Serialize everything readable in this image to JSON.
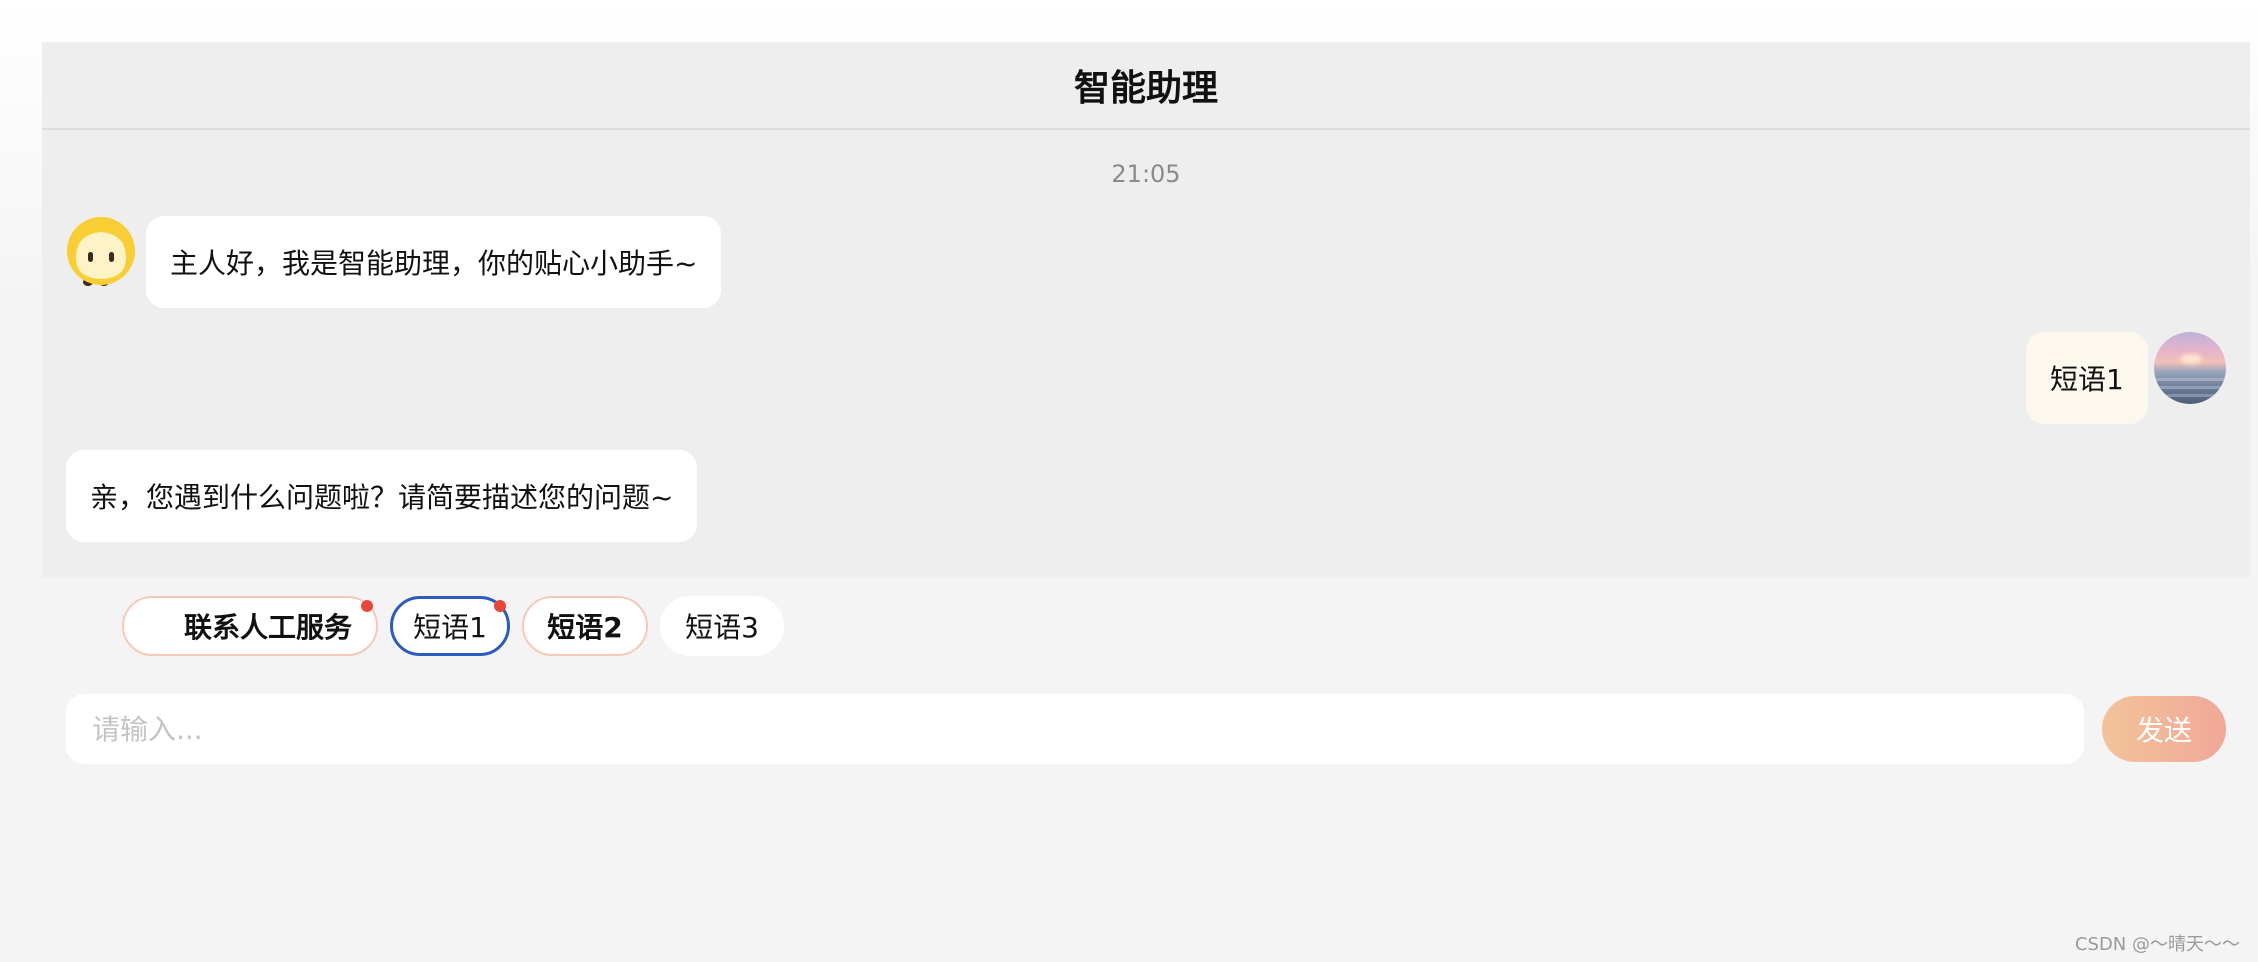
{
  "header": {
    "title": "智能助理"
  },
  "chat": {
    "time": "21:05",
    "messages": [
      {
        "from": "bot",
        "text": "主人好，我是智能助理，你的贴心小助手~"
      },
      {
        "from": "user",
        "text": "短语1"
      },
      {
        "from": "bot",
        "text": "亲，您遇到什么问题啦？请简要描述您的问题~"
      }
    ]
  },
  "quick_replies": [
    {
      "label": "联系人工服务",
      "has_dot": true
    },
    {
      "label": "短语1",
      "has_dot": true,
      "selected": true
    },
    {
      "label": "短语2",
      "has_dot": false
    },
    {
      "label": "短语3",
      "has_dot": false
    }
  ],
  "input": {
    "placeholder": "请输入...",
    "value": ""
  },
  "send_button": {
    "label": "发送"
  },
  "watermark": "CSDN @～晴天～～",
  "colors": {
    "panel_bg": "#eeeeee",
    "user_bubble": "#fdf8ee",
    "active_chip_border": "#2a5bbd",
    "chip_border": "#f6c9b6",
    "notification_dot": "#e8473c",
    "send_gradient_start": "#f3c39a",
    "send_gradient_end": "#f0a897"
  },
  "icons": {
    "bot_avatar": "yellow-robot-avatar-icon",
    "user_avatar": "sunset-sea-avatar-icon"
  }
}
